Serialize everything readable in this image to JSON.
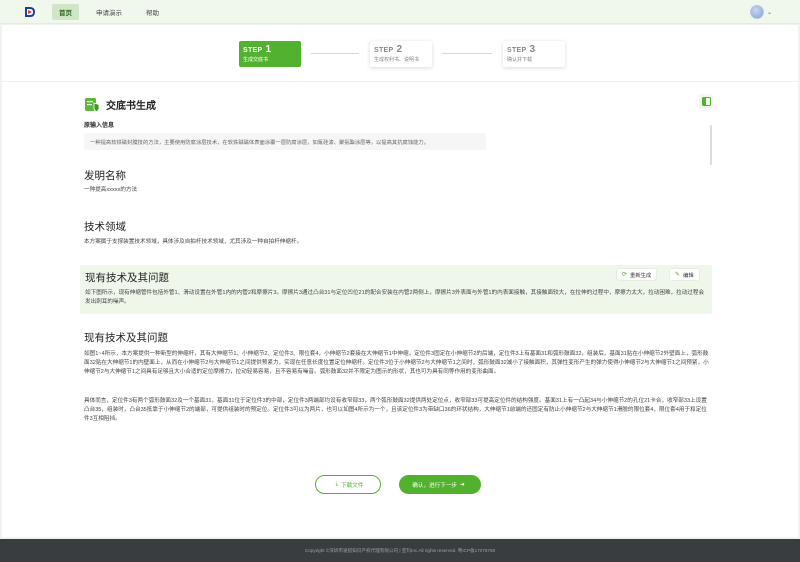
{
  "nav": {
    "items": [
      {
        "label": "首页",
        "active": true
      },
      {
        "label": "申请演示",
        "active": false
      },
      {
        "label": "帮助",
        "active": false
      }
    ],
    "chevron": "⌄"
  },
  "steps": [
    {
      "step_label": "STEP",
      "number": "1",
      "title": "生成交底书",
      "state": "active"
    },
    {
      "step_label": "STEP",
      "number": "2",
      "title": "生成权利书、说明书",
      "state": "inactive"
    },
    {
      "step_label": "STEP",
      "number": "3",
      "title": "确认并下载",
      "state": "inactive"
    }
  ],
  "doc": {
    "title": "交底书生成",
    "original_label": "原输入信息",
    "original_text": "一种提高软铁磁封膜技的方法，主要使用防腐涂层技术，在软铁磁磁体表面涂覆一层防腐涂层，如氟硅漆、聚氨酯涂层等，以提高其抗腐蚀能力。"
  },
  "sections": {
    "invention_name": {
      "title": "发明名称",
      "text": "一种提高xxxxx的方法"
    },
    "tech_field": {
      "title": "技术领域",
      "text": "本方案属于支撑装置技术领域，具体涉及自拍杆技术领域，尤其涉及一种自拍杆伸缩杆。"
    },
    "prior_art": {
      "title": "现有技术及其问题",
      "text": "如下图所示，现有伸缩管件包括外管1、滑动设置在外管1内的内管2和摩擦片3。摩擦片3通过凸台31与定位凹位21的配合安装在内管2两侧上，摩擦片3外表面与外管1的内表面接触，其接触面较大，在拉伸的过程中，摩擦力太大，拉动困难，拉动过程会发出刺耳的噪声。",
      "regen_label": "重新生成",
      "edit_label": "编辑"
    },
    "solution": {
      "title": "现有技术及其问题",
      "p1": "如图1~4所示，本方案提供一种新型的伸缩杆，其有大伸缩节1、小伸缩节2、定位件3、限位套4，小伸缩节2套接在大伸缩节1中伸缩，定位件3固定在小伸缩节2的后端，定位件3上有基面31和弧形鼓面32，组装后，基面31贴在小伸缩节2外壁面上，弧形鼓面32贴在大伸缩节1的内壁面上，从而在小伸缩节2与大伸缩节1之间提供预紧力，实现在任意长度位置定位伸缩杆。定位件3位于小伸缩节2与大伸缩节1之间时，弧形鼓面32减小了接触面积，其弹性变形产生的弹力使得小伸缩节2与大伸缩节1之间预紧，小伸缩节2与大伸缩节1之间具有足够且大小合适的定位摩擦力，拉动轻易容易，且不容易有噪音。弧形鼓面32并不限定为图示的形状，其也可为具有同等作用的变形曲面。",
      "p2": "具体而言，定位件3有两个弧形鼓面32及一个基面31，基面31位于定位件3的中部，定位件3两端部均设有收窄部33，两个弧形鼓面32提供两处定位点，收窄部33可提高定位件的结构强度。基面31上有一凸起34与小伸缩节2的孔位21卡合，收窄部33上设置凸台35，组装时，凸台35抵靠于小伸缩节2的端部，可提供组装时的预定位。定位件3可以为两片，也可以如图4所示为一个，且该定位件3为带缺口36的环状结构，大伸缩节1前端的还固定有防止小伸缩节2与大伸缩节1滑脱的限位套4，限位套4用于和定位件3互相阻挡。"
    }
  },
  "actions": {
    "download_label": "下载文件",
    "next_label": "确认，进行下一步"
  },
  "footer": {
    "text": "Copyright ©深圳市速搭知识产权代理有限公司 | 亚玛Inc.All rights reserved.    粤ICP备17076768"
  },
  "colors": {
    "accent": "#52b230",
    "footer_bg": "#3a3d40"
  }
}
